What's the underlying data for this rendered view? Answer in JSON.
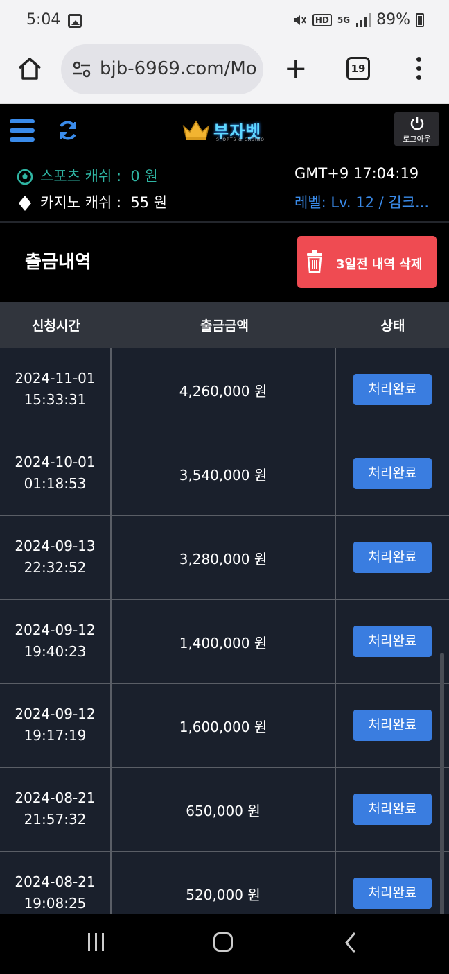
{
  "status_bar": {
    "time": "5:04",
    "battery": "89%",
    "icons": [
      "photo-icon",
      "mute-icon",
      "hd-icon",
      "5g-icon",
      "signal-icon",
      "battery-icon"
    ]
  },
  "browser": {
    "url": "bjb-6969.com/Mo",
    "tab_count": "19"
  },
  "header": {
    "logo_text": "부자벳",
    "logo_sub": "SPORTS & CASINO",
    "logout_label": "로그아웃",
    "sports_cash_label": "스포츠 캐쉬 :",
    "sports_cash_value": "0 원",
    "casino_cash_label": "카지노 캐쉬 :",
    "casino_cash_value": "55 원",
    "gmt_time": "GMT+9 17:04:19",
    "level": "레벨: Lv. 12 / 김크...",
    "colors": {
      "accent_blue": "#3a8bea",
      "sports_teal": "#2fb5a3"
    }
  },
  "page": {
    "title": "출금내역",
    "delete_button": "3일전 내역 삭제",
    "delete_color": "#ef4b52"
  },
  "table": {
    "columns": [
      "신청시간",
      "출금금액",
      "상태"
    ],
    "rows": [
      {
        "date": "2024-11-01",
        "time": "15:33:31",
        "amount": "4,260,000 원",
        "status": "처리완료"
      },
      {
        "date": "2024-10-01",
        "time": "01:18:53",
        "amount": "3,540,000 원",
        "status": "처리완료"
      },
      {
        "date": "2024-09-13",
        "time": "22:32:52",
        "amount": "3,280,000 원",
        "status": "처리완료"
      },
      {
        "date": "2024-09-12",
        "time": "19:40:23",
        "amount": "1,400,000 원",
        "status": "처리완료"
      },
      {
        "date": "2024-09-12",
        "time": "19:17:19",
        "amount": "1,600,000 원",
        "status": "처리완료"
      },
      {
        "date": "2024-08-21",
        "time": "21:57:32",
        "amount": "650,000 원",
        "status": "처리완료"
      },
      {
        "date": "2024-08-21",
        "time": "19:08:25",
        "amount": "520,000 원",
        "status": "처리완료"
      }
    ]
  }
}
